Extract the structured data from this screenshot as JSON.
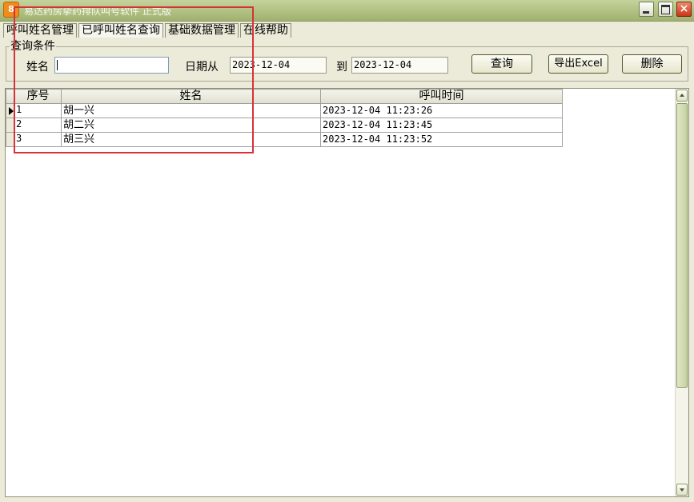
{
  "window": {
    "title": "易达药房挚药排队叫号软件 正式版",
    "icon": "app-logo-icon",
    "close_glyph": "×"
  },
  "tabs": [
    {
      "label": "呼叫姓名管理"
    },
    {
      "label": "已呼叫姓名查询",
      "active": true
    },
    {
      "label": "基础数据管理"
    },
    {
      "label": "在线帮助"
    }
  ],
  "query": {
    "legend": "查询条件",
    "name_label": "姓名",
    "name_value": "",
    "date_from_label": "日期从",
    "date_from": "2023-12-04",
    "to_label": "到",
    "date_to": "2023-12-04",
    "search_button": "查询",
    "export_button": "导出Excel",
    "delete_button": "删除"
  },
  "table": {
    "columns": [
      "序号",
      "姓名",
      "呼叫时间"
    ],
    "rows": [
      {
        "seq": "1",
        "name": "胡一兴",
        "time": "2023-12-04 11:23:26",
        "current": true
      },
      {
        "seq": "2",
        "name": "胡二兴",
        "time": "2023-12-04 11:23:45"
      },
      {
        "seq": "3",
        "name": "胡三兴",
        "time": "2023-12-04 11:23:52"
      }
    ]
  },
  "colors": {
    "highlight": "#d6323a",
    "titlebar": "#aebf7f",
    "window_bg": "#ecebd9"
  }
}
